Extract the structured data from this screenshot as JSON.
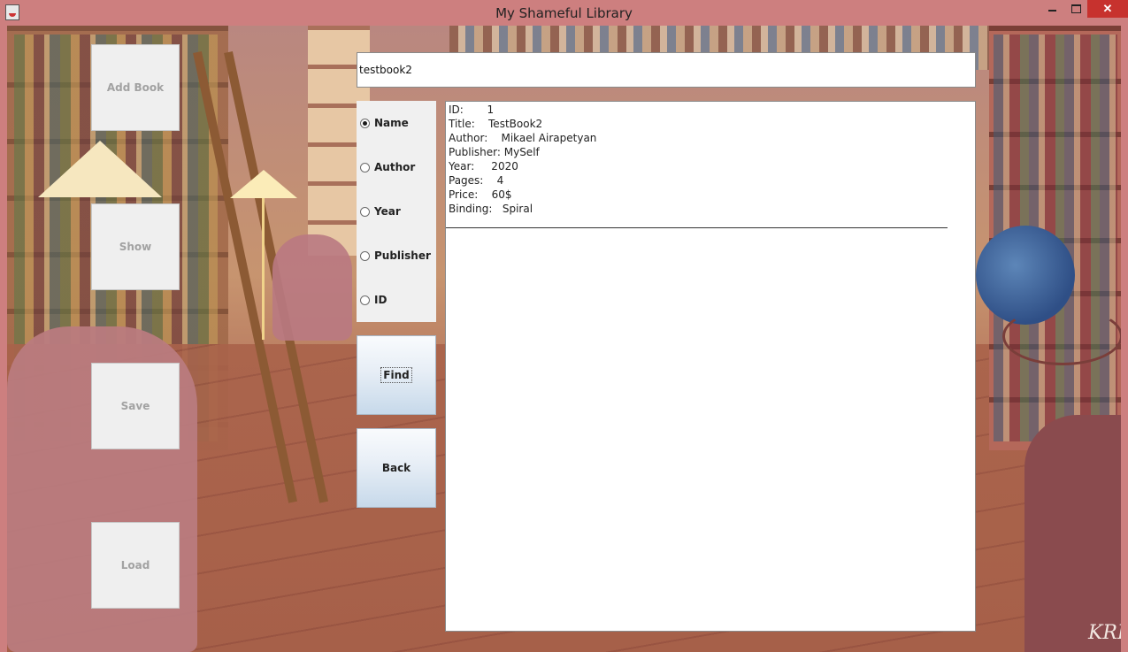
{
  "window": {
    "title": "My Shameful Library",
    "controls": {
      "minimize_icon": "minimize-icon",
      "maximize_icon": "maximize-icon",
      "close_symbol": "✕"
    }
  },
  "sidebar": {
    "buttons": [
      {
        "label": "Add Book"
      },
      {
        "label": "Show"
      },
      {
        "label": "Save"
      },
      {
        "label": "Load"
      }
    ]
  },
  "search": {
    "value": "testbook2"
  },
  "search_by": {
    "options": [
      {
        "label": "Name",
        "selected": true
      },
      {
        "label": "Author",
        "selected": false
      },
      {
        "label": "Year",
        "selected": false
      },
      {
        "label": "Publisher",
        "selected": false
      },
      {
        "label": "ID",
        "selected": false
      }
    ]
  },
  "actions": {
    "find_label": "Find",
    "back_label": "Back"
  },
  "result": {
    "lines": [
      "ID:       1",
      "Title:    TestBook2",
      "Author:    Mikael Airapetyan",
      "Publisher: MySelf",
      "Year:     2020",
      "Pages:    4",
      "Price:    60$",
      "Binding:   Spiral"
    ]
  }
}
